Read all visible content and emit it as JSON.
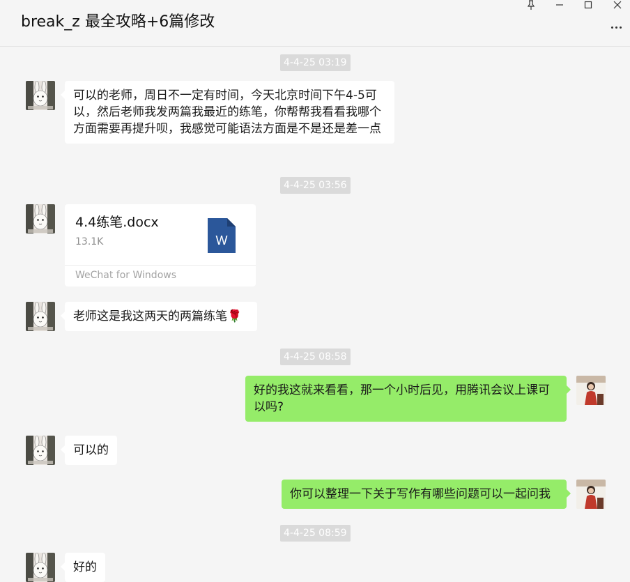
{
  "window": {
    "title": "break_z 最全攻略+6篇修改"
  },
  "messages": {
    "ts1": "4-4-25 03:19",
    "m1": "可以的老师，周日不一定有时间，今天北京时间下午4-5可以，然后老师我发两篇我最近的练笔，你帮帮我看看我哪个方面需要再提升呗，我感觉可能语法方面是不是还是差一点",
    "ts2": "4-4-25 03:56",
    "file": {
      "name": "4.4练笔.docx",
      "size": "13.1K",
      "source": "WeChat for Windows",
      "icon": "word-doc-icon"
    },
    "m2": "老师这是我这两天的两篇练笔",
    "m2_emoji": "🌹",
    "ts3": "4-4-25 08:58",
    "m3": "好的我这就来看看，那一个小时后见，用腾讯会议上课可以吗?",
    "m4": "可以的",
    "m5": "你可以整理一下关于写作有哪些问题可以一起问我",
    "ts4": "4-4-25 08:59",
    "m6": "好的"
  },
  "colors": {
    "background": "#f5f5f5",
    "incoming_bubble": "#ffffff",
    "outgoing_bubble": "#95ec69",
    "timestamp_bg": "#dadada",
    "word_blue": "#2b579a"
  }
}
